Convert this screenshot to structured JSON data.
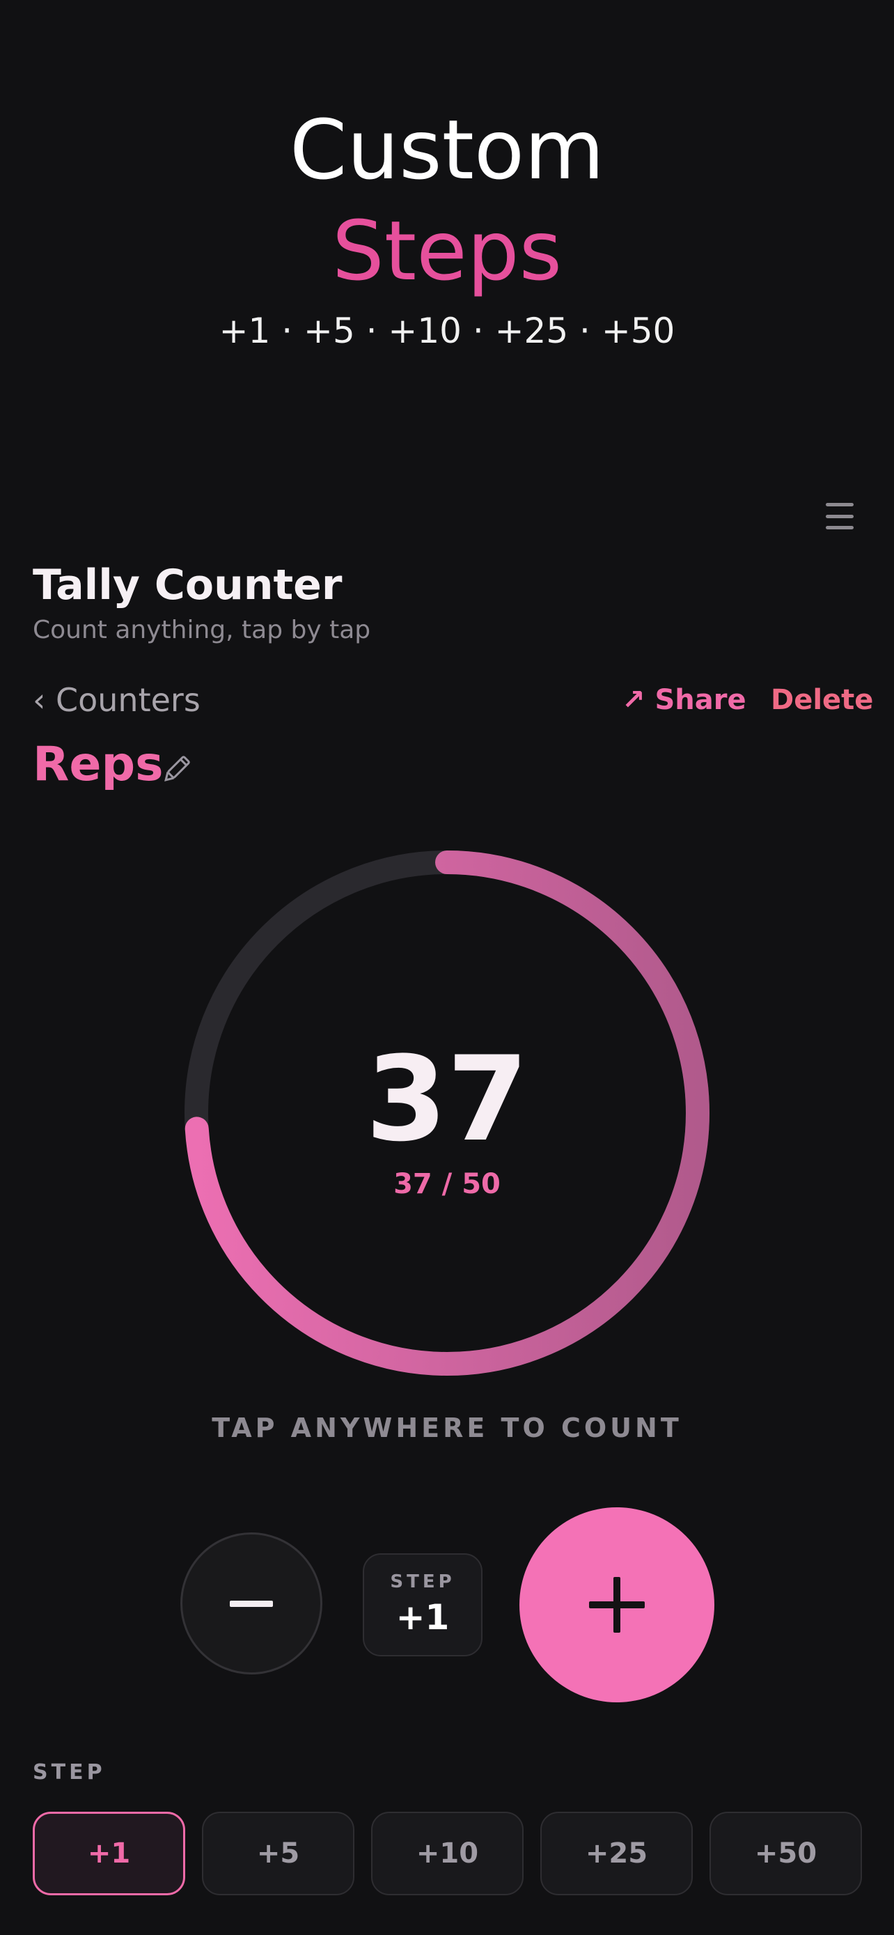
{
  "hero": {
    "title": "Custom",
    "accent": "Steps",
    "subtitle": "+1 · +5 · +10 · +25 · +50"
  },
  "menu": {
    "icon": "hamburger-menu-icon"
  },
  "app": {
    "title": "Tally Counter",
    "subtitle": "Count anything, tap by tap"
  },
  "nav": {
    "back_label": "‹ Counters",
    "share_label": "↗ Share",
    "delete_label": "Delete"
  },
  "counter": {
    "name": "Reps",
    "edit_icon": "pencil-icon",
    "value": "37",
    "progress_text": "37 / 50",
    "progress_fraction": 0.74,
    "hint": "TAP ANYWHERE TO COUNT"
  },
  "controls": {
    "minus_icon": "minus-icon",
    "plus_icon": "plus-icon",
    "step_label": "STEP",
    "step_value": "+1"
  },
  "steps": {
    "heading": "STEP",
    "options": [
      "+1",
      "+5",
      "+10",
      "+25",
      "+50"
    ],
    "selected": "+1"
  },
  "colors": {
    "accent": "#f472b6",
    "ring_track": "#2a292e",
    "ring_start": "#ec6fb2",
    "ring_end": "#b15a8c",
    "background": "#111113",
    "delete": "#ef6a85"
  }
}
